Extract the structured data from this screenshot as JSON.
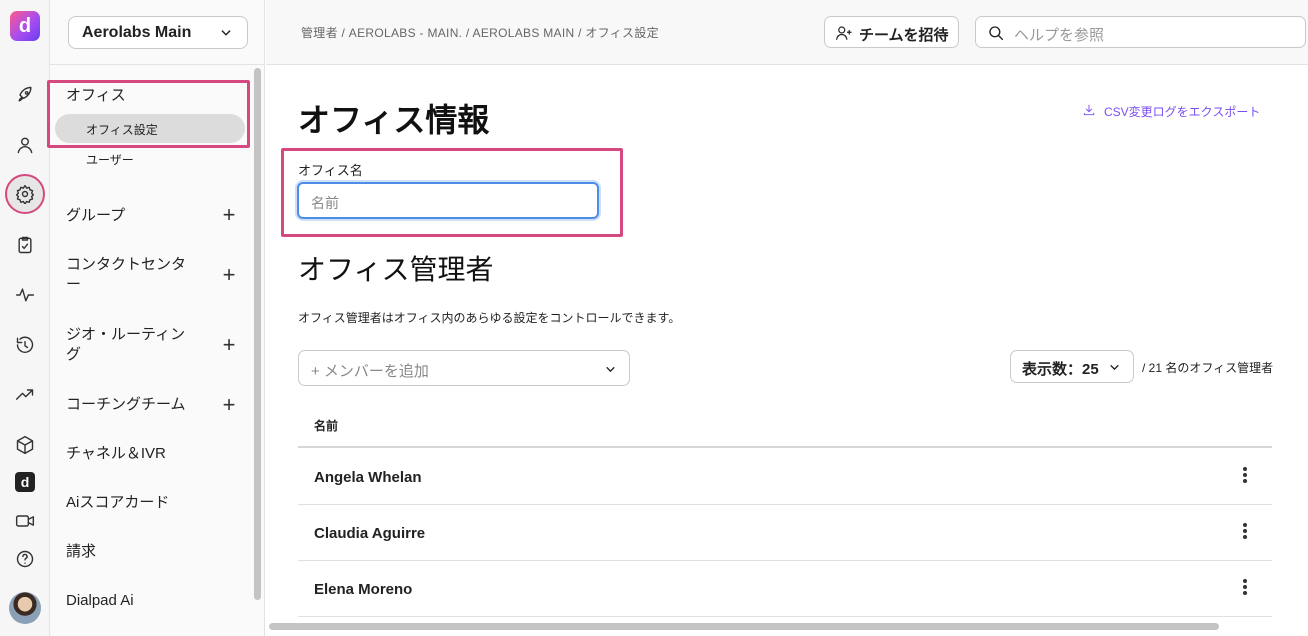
{
  "rail": {
    "logo_letter": "d",
    "logo2_letter": "d",
    "icons": [
      "rocket-icon",
      "user-icon",
      "gear-icon",
      "clipboard-icon",
      "activity-icon",
      "history-icon",
      "trending-icon",
      "cube-icon",
      "dialpad-icon",
      "video-icon",
      "help-icon",
      "avatar"
    ]
  },
  "sidebar": {
    "workspace": "Aerolabs Main",
    "office_section": "オフィス",
    "office_settings": "オフィス設定",
    "users": "ユーザー",
    "groups": "グループ",
    "contact_center": "コンタクトセンター",
    "geo_routing": "ジオ・ルーティング",
    "coaching_team": "コーチングチーム",
    "channels_ivr": "チャネル＆IVR",
    "ai_scorecard": "Aiスコアカード",
    "billing": "請求",
    "dialpad_ai": "Dialpad Ai"
  },
  "topbar": {
    "breadcrumb": "管理者 / AEROLABS - MAIN. / AEROLABS MAIN / オフィス設定",
    "invite_label": "チームを招待",
    "search_placeholder": "ヘルプを参照"
  },
  "main": {
    "title": "オフィス情報",
    "export_label": "CSV変更ログをエクスポート",
    "office_name_label": "オフィス名",
    "office_name_placeholder": "名前",
    "admins_title": "オフィス管理者",
    "admins_description": "オフィス管理者はオフィス内のあらゆる設定をコントロールできます。",
    "add_member_placeholder": "+ メンバーを追加",
    "page_size_label": "表示数：25",
    "admin_count": "/ 21 名のオフィス管理者",
    "column_name": "名前",
    "rows": [
      "Angela Whelan",
      "Claudia Aguirre",
      "Elena Moreno"
    ]
  },
  "colors": {
    "accent": "#7b4ff0",
    "highlight": "#d4497f",
    "focus": "#4c8ee6"
  }
}
